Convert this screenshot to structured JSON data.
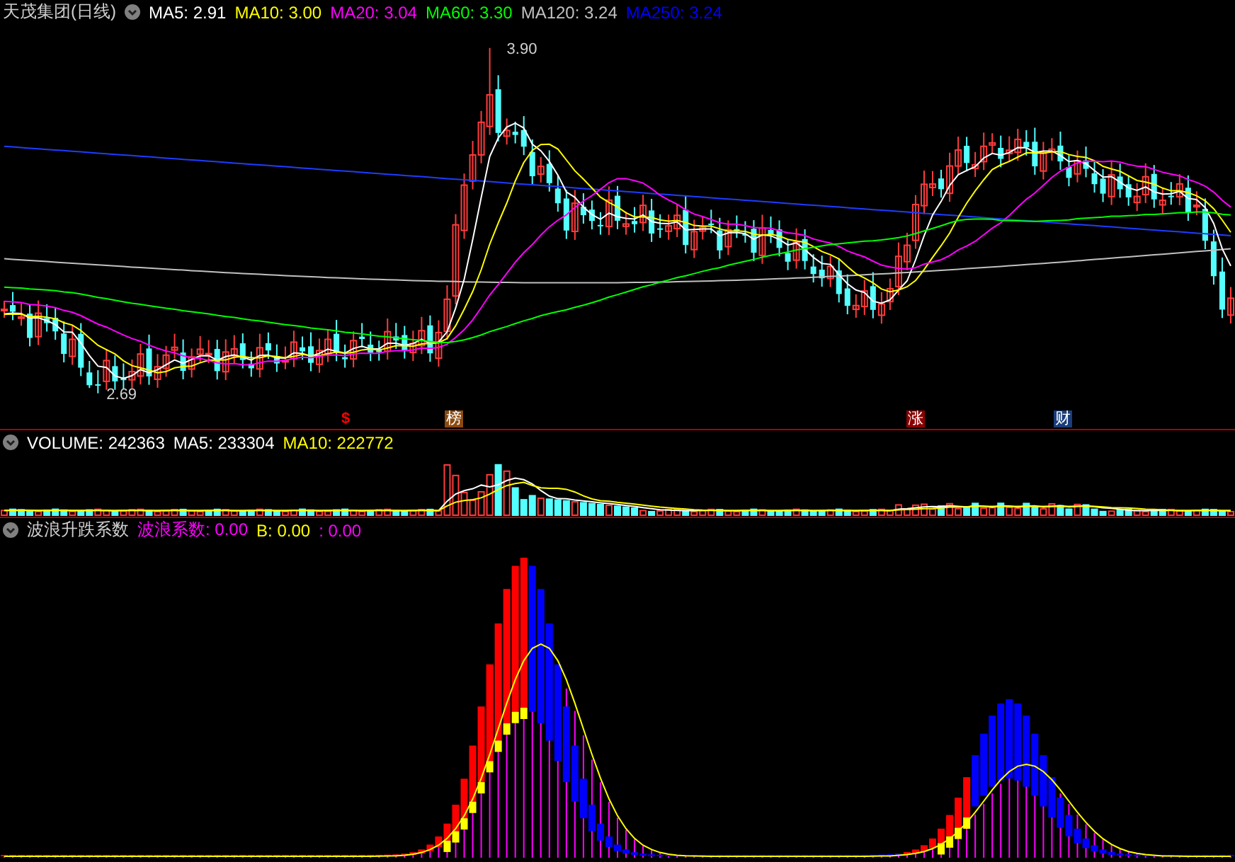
{
  "main": {
    "title": "天茂集团(日线)",
    "indicators": [
      {
        "label": "MA5: 2.91",
        "color": "#ffffff"
      },
      {
        "label": "MA10: 3.00",
        "color": "#ffff00"
      },
      {
        "label": "MA20: 3.04",
        "color": "#ff00ff"
      },
      {
        "label": "MA60: 3.30",
        "color": "#00ff00"
      },
      {
        "label": "MA120: 3.24",
        "color": "#c0c0c0"
      },
      {
        "label": "MA250: 3.24",
        "color": "#0000ff"
      }
    ],
    "high_label": "3.90",
    "low_label": "2.69",
    "markers": [
      {
        "text": "$",
        "color": "#ff0000"
      },
      {
        "text": "榜",
        "color": "#8b4a10"
      },
      {
        "text": "涨",
        "color": "#8b0000"
      },
      {
        "text": "财",
        "color": "#1a3d7a"
      }
    ]
  },
  "volume": {
    "indicators": [
      {
        "label": "VOLUME: 242363",
        "color": "#ffffff"
      },
      {
        "label": "MA5: 233304",
        "color": "#ffffff"
      },
      {
        "label": "MA10: 222772",
        "color": "#ffff00"
      }
    ]
  },
  "wave": {
    "title": "波浪升跌系数",
    "indicators": [
      {
        "label": "波浪系数: 0.00",
        "color": "#ff00ff"
      },
      {
        "label": "B: 0.00",
        "color": "#ffff00"
      },
      {
        "label": ": 0.00",
        "color": "#ff00ff"
      }
    ]
  }
}
